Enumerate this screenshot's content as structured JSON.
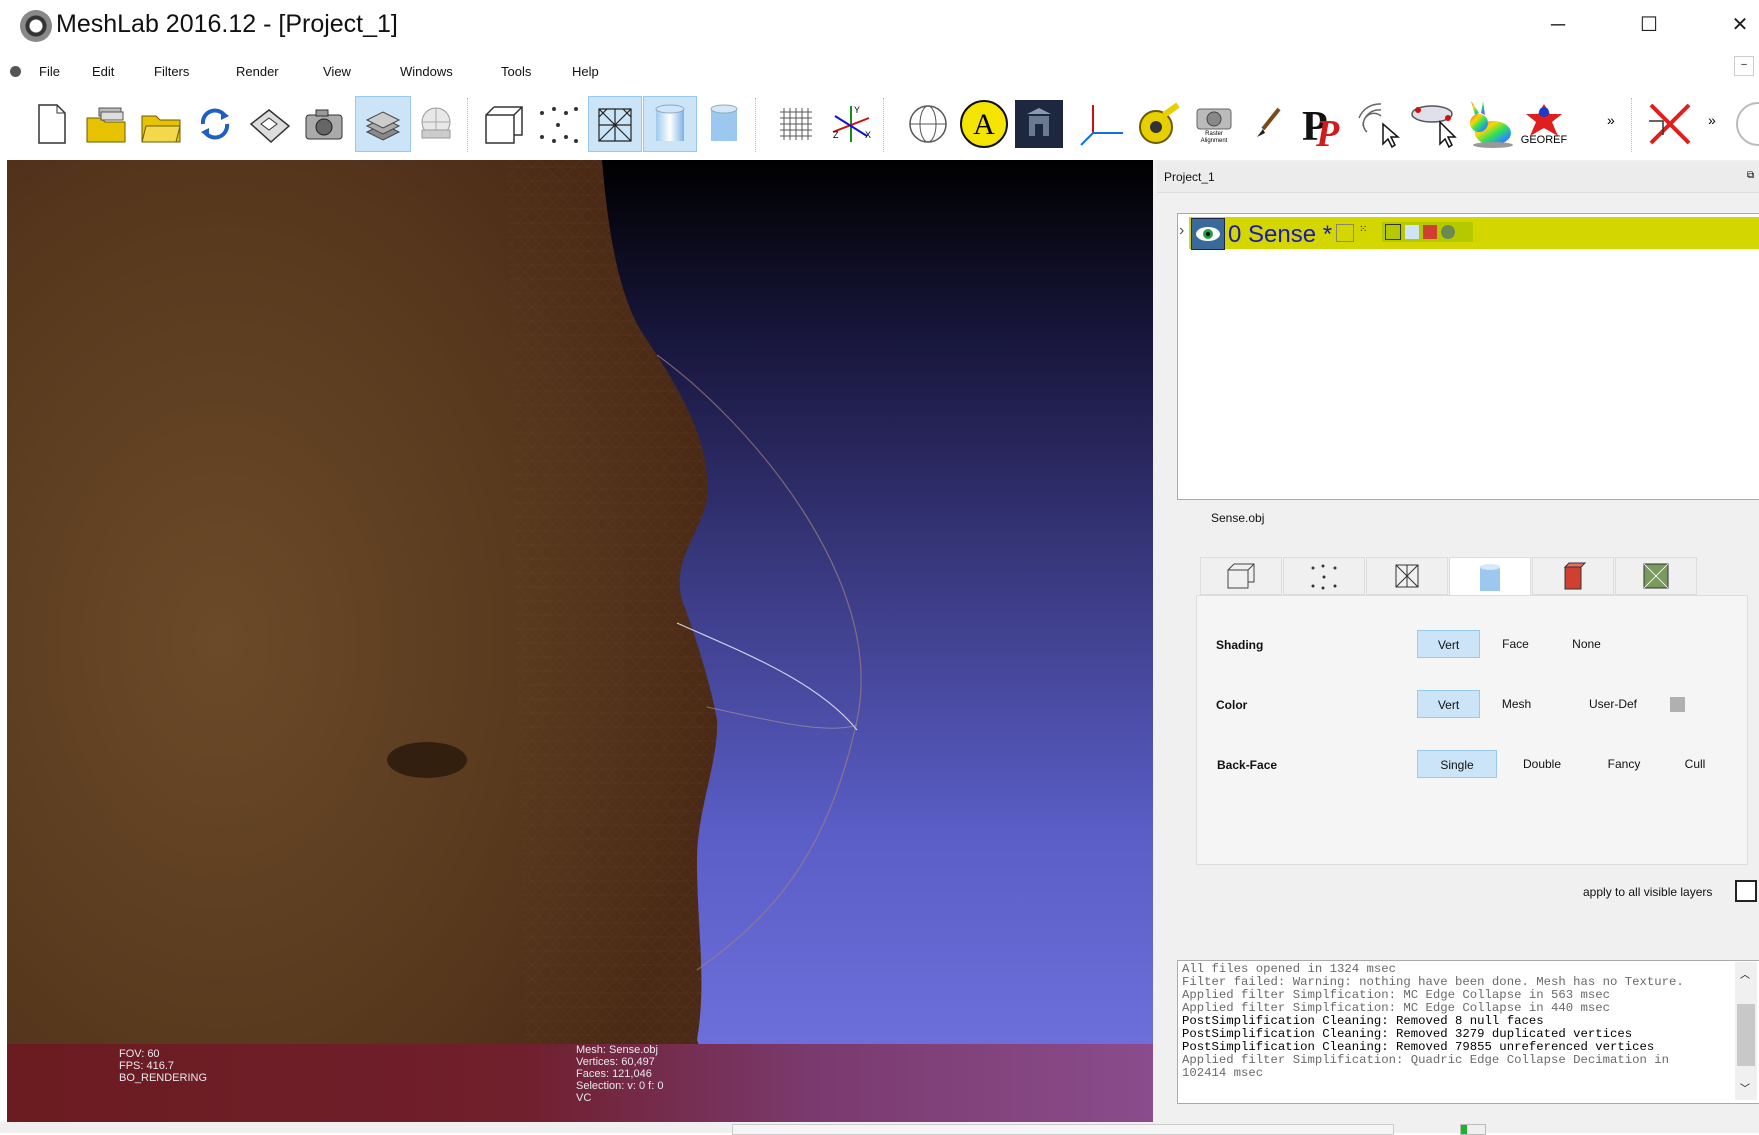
{
  "window": {
    "title": "MeshLab 2016.12 - [Project_1]",
    "minimize": "─",
    "maximize": "☐",
    "close": "✕"
  },
  "menu": [
    "File",
    "Edit",
    "Filters",
    "Render",
    "View",
    "Windows",
    "Tools",
    "Help"
  ],
  "toolbar": {
    "icons": [
      "new-project",
      "open-project",
      "import-mesh",
      "reload",
      "export-mesh",
      "snapshot",
      "show-layers",
      "show-raster",
      "bbox",
      "points",
      "wireframe",
      "smooth",
      "flat",
      "grid",
      "axes",
      "trackball",
      "annotation",
      "image-stack",
      "frame",
      "measure-tape",
      "raster-alignment",
      "paint",
      "pickpoints",
      "select",
      "align",
      "bunny",
      "georef",
      "delete"
    ],
    "raster_label": "Raster Alignment",
    "georef_label": "GEOREF",
    "overflow": "»"
  },
  "viewport": {
    "overlay_left": [
      "FOV: 60",
      "FPS:   416.7",
      "BO_RENDERING"
    ],
    "overlay_right": [
      "Mesh: Sense.obj",
      "Vertices: 60,497",
      "Faces: 121,046",
      "Selection: v: 0 f: 0",
      "VC"
    ]
  },
  "panel": {
    "title": "Project_1",
    "layer": {
      "index": "0",
      "name": "Sense",
      "modified": "*"
    },
    "info_file": "Sense.obj",
    "tabs": [
      "bbox",
      "points",
      "wireframe",
      "solid",
      "texture",
      "texture-mesh"
    ],
    "active_tab": 3,
    "shading": {
      "label": "Shading",
      "options": [
        "Vert",
        "Face",
        "None"
      ],
      "selected": "Vert"
    },
    "color": {
      "label": "Color",
      "options": [
        "Vert",
        "Mesh",
        "User-Def"
      ],
      "selected": "Vert"
    },
    "backface": {
      "label": "Back-Face",
      "options": [
        "Single",
        "Double",
        "Fancy",
        "Cull"
      ],
      "selected": "Single"
    },
    "apply_all": "apply to all visible layers"
  },
  "log": [
    {
      "text": "All files opened in 1324 msec",
      "style": "gray"
    },
    {
      "text": "Filter failed: Warning: nothing have been done. Mesh has no Texture.",
      "style": "gray"
    },
    {
      "text": "Applied filter Simplfication: MC Edge Collapse in 563 msec",
      "style": "gray"
    },
    {
      "text": "Applied filter Simplfication: MC Edge Collapse in 440 msec",
      "style": "gray"
    },
    {
      "text": "PostSimplification Cleaning: Removed 8 null faces",
      "style": "black"
    },
    {
      "text": "PostSimplification Cleaning: Removed 3279 duplicated vertices",
      "style": "black"
    },
    {
      "text": "PostSimplification Cleaning: Removed 79855 unreferenced vertices",
      "style": "black"
    },
    {
      "text": "Applied filter Simplification: Quadric Edge Collapse Decimation in",
      "style": "gray"
    },
    {
      "text": "102414 msec",
      "style": "gray"
    }
  ],
  "colors": {
    "layer_highlight": "#d4d600",
    "layer_text": "#1a1ab0",
    "selected_option": "#cce4f7"
  }
}
